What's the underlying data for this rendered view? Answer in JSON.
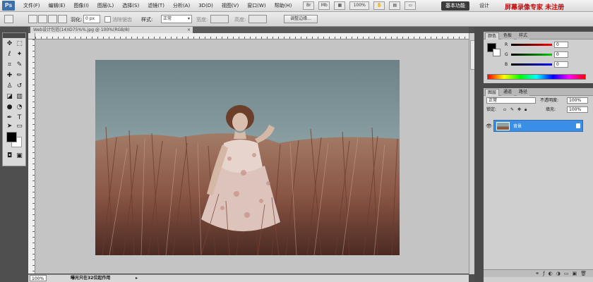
{
  "menubar": {
    "logo": "Ps",
    "menus": [
      "文件(F)",
      "编辑(E)",
      "图像(I)",
      "图层(L)",
      "选择(S)",
      "滤镜(T)",
      "分析(A)",
      "3D(D)",
      "视图(V)",
      "窗口(W)",
      "帮助(H)"
    ],
    "zoom_value": "100%",
    "workspaces": [
      "基本功能",
      "设计",
      "绘画"
    ],
    "watermark": "屏幕录像专家 未注册"
  },
  "options": {
    "feather_label": "羽化:",
    "feather_value": "0 px",
    "antialias_label": "消除锯齿",
    "style_label": "样式:",
    "style_value": "正常",
    "width_label": "宽度:",
    "height_label": "高度:",
    "refine_edge": "调整边缘..."
  },
  "document": {
    "tab_title": "Web设计包括(14)ID75%%.jpg @ 100%(RGB/8)",
    "status_zoom": "100%",
    "status_info": "曝光只在32位起作用"
  },
  "color_panel": {
    "tabs": [
      "颜色",
      "色板",
      "样式"
    ],
    "r_label": "R",
    "g_label": "G",
    "b_label": "B",
    "r_value": "0",
    "g_value": "0",
    "b_value": "0"
  },
  "layers_panel": {
    "tabs": [
      "图层",
      "通道",
      "路径"
    ],
    "blend_mode": "正常",
    "opacity_label": "不透明度:",
    "opacity_value": "100%",
    "lock_label": "锁定:",
    "fill_label": "填充:",
    "fill_value": "100%",
    "layer_name": "背景"
  },
  "colors": {
    "accent_selection": "#3a8ee6",
    "menu_watermark": "#c20a0a"
  }
}
